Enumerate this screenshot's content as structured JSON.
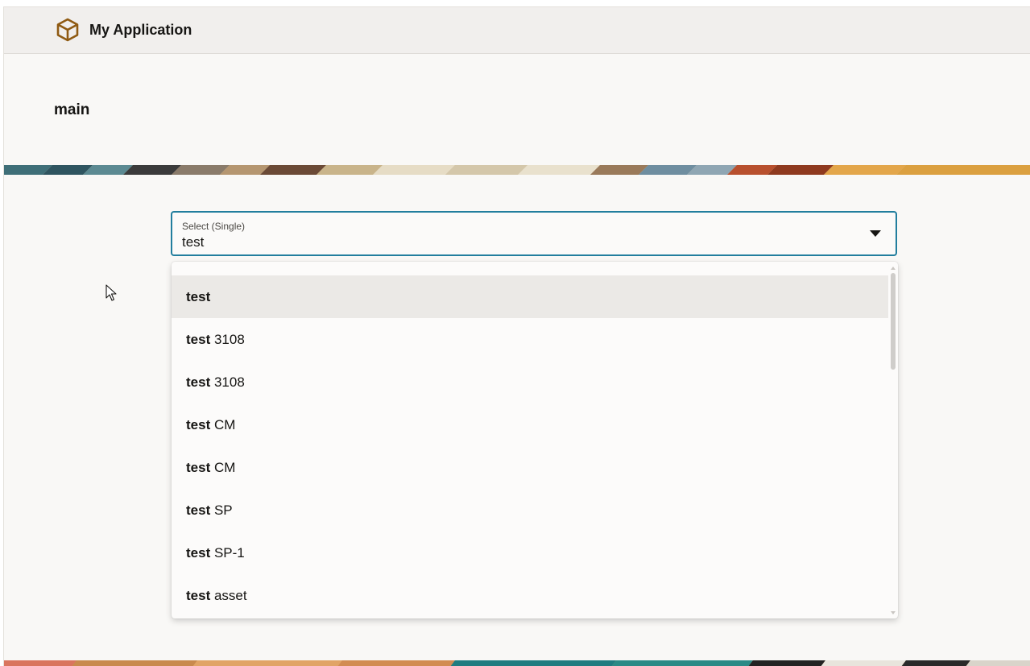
{
  "header": {
    "logo_icon": "cube-icon",
    "app_title": "My Application"
  },
  "page": {
    "title": "main"
  },
  "select": {
    "label": "Select (Single)",
    "value": "test",
    "caret_icon": "caret-down-icon"
  },
  "dropdown": {
    "match": "test",
    "options": [
      {
        "bold": "test",
        "rest": "",
        "active": true
      },
      {
        "bold": "test",
        "rest": " 3108",
        "active": false
      },
      {
        "bold": "test",
        "rest": " 3108",
        "active": false
      },
      {
        "bold": "test",
        "rest": " CM",
        "active": false
      },
      {
        "bold": "test",
        "rest": " CM",
        "active": false
      },
      {
        "bold": "test",
        "rest": " SP",
        "active": false
      },
      {
        "bold": "test",
        "rest": " SP-1",
        "active": false
      },
      {
        "bold": "test",
        "rest": " asset",
        "active": false
      }
    ]
  },
  "colors": {
    "accent": "#227e9e",
    "logo": "#8f5a12",
    "header_bg": "#f1efed",
    "page_bg": "#f9f8f6"
  }
}
